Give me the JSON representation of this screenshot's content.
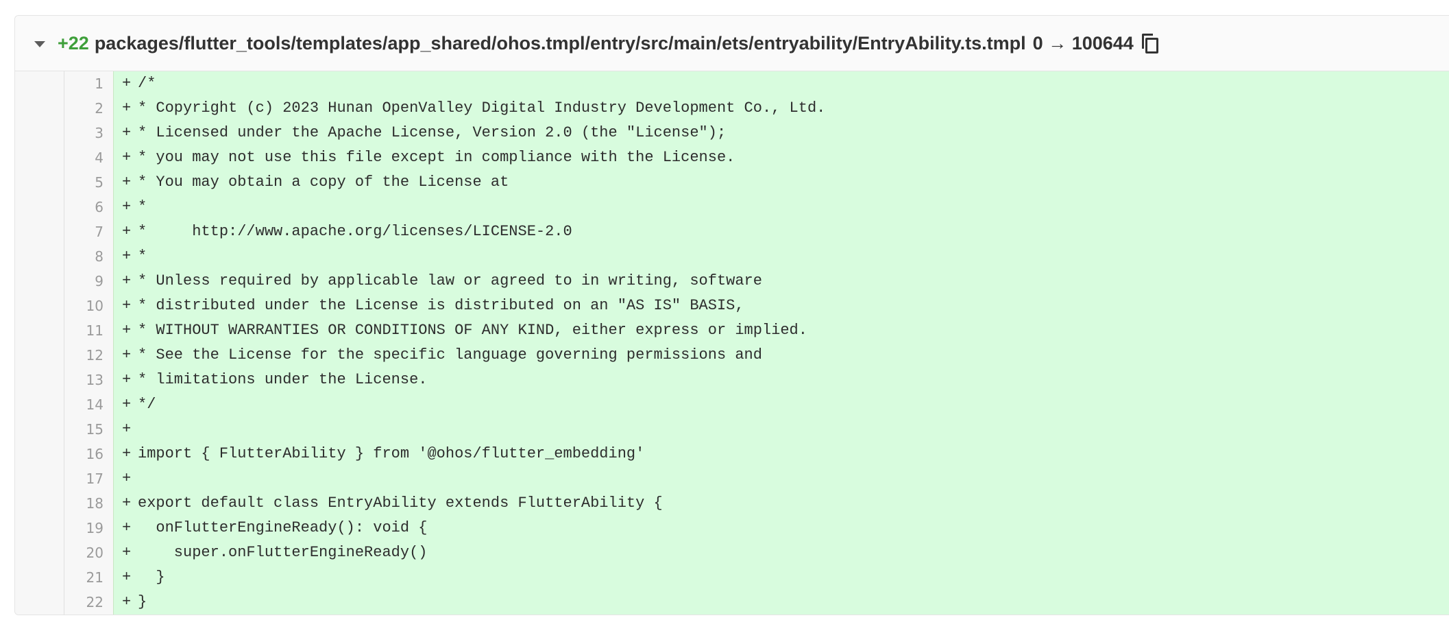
{
  "diff": {
    "added_count": "+22",
    "file_path": "packages/flutter_tools/templates/app_shared/ohos.tmpl/entry/src/main/ets/entryability/EntryAbility.ts.tmpl",
    "mode_change": "0 → 100644",
    "line_marker": "+",
    "lines": [
      {
        "num": "1",
        "code": "/*"
      },
      {
        "num": "2",
        "code": "* Copyright (c) 2023 Hunan OpenValley Digital Industry Development Co., Ltd."
      },
      {
        "num": "3",
        "code": "* Licensed under the Apache License, Version 2.0 (the \"License\");"
      },
      {
        "num": "4",
        "code": "* you may not use this file except in compliance with the License."
      },
      {
        "num": "5",
        "code": "* You may obtain a copy of the License at"
      },
      {
        "num": "6",
        "code": "*"
      },
      {
        "num": "7",
        "code": "*     http://www.apache.org/licenses/LICENSE-2.0"
      },
      {
        "num": "8",
        "code": "*"
      },
      {
        "num": "9",
        "code": "* Unless required by applicable law or agreed to in writing, software"
      },
      {
        "num": "10",
        "code": "* distributed under the License is distributed on an \"AS IS\" BASIS,"
      },
      {
        "num": "11",
        "code": "* WITHOUT WARRANTIES OR CONDITIONS OF ANY KIND, either express or implied."
      },
      {
        "num": "12",
        "code": "* See the License for the specific language governing permissions and"
      },
      {
        "num": "13",
        "code": "* limitations under the License."
      },
      {
        "num": "14",
        "code": "*/"
      },
      {
        "num": "15",
        "code": ""
      },
      {
        "num": "16",
        "code": "import { FlutterAbility } from '@ohos/flutter_embedding'"
      },
      {
        "num": "17",
        "code": ""
      },
      {
        "num": "18",
        "code": "export default class EntryAbility extends FlutterAbility {"
      },
      {
        "num": "19",
        "code": "  onFlutterEngineReady(): void {"
      },
      {
        "num": "20",
        "code": "    super.onFlutterEngineReady()"
      },
      {
        "num": "21",
        "code": "  }"
      },
      {
        "num": "22",
        "code": "}"
      }
    ]
  },
  "icons": {
    "collapse": "chevron-down-icon",
    "copy": "copy-icon"
  },
  "colors": {
    "added_text": "#3e9f3a",
    "added_line_bg": "#d8fcde",
    "gutter_bg": "#f7f7f7"
  }
}
